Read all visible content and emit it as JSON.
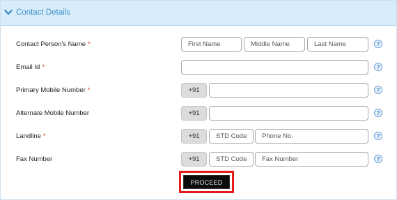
{
  "section": {
    "title": "Contact Details",
    "toggle_icon": "chevron-down-icon",
    "accent": "#3c8ec9"
  },
  "rows": {
    "name": {
      "label": "Contact Person's Name",
      "required": "*",
      "first_placeholder": "First Name",
      "middle_placeholder": "Middle Name",
      "last_placeholder": "Last Name"
    },
    "email": {
      "label": "Email Id",
      "required": "*",
      "value": ""
    },
    "primary_mobile": {
      "label": "Primary Mobile Number",
      "required": "*",
      "code": "+91",
      "value": ""
    },
    "alternate_mobile": {
      "label": "Alternate Mobile Number",
      "code": "+91",
      "value": ""
    },
    "landline": {
      "label": "Landline",
      "required": "*",
      "code": "+91",
      "std_placeholder": "STD Code",
      "phone_placeholder": "Phone No."
    },
    "fax": {
      "label": "Fax Number",
      "code": "+91",
      "std_placeholder": "STD Code",
      "fax_placeholder": "Fax Number"
    }
  },
  "help_icon": {
    "glyph": "?",
    "name": "help-icon"
  },
  "actions": {
    "proceed_label": "PROCEED",
    "highlight_color": "#e21b1b"
  }
}
